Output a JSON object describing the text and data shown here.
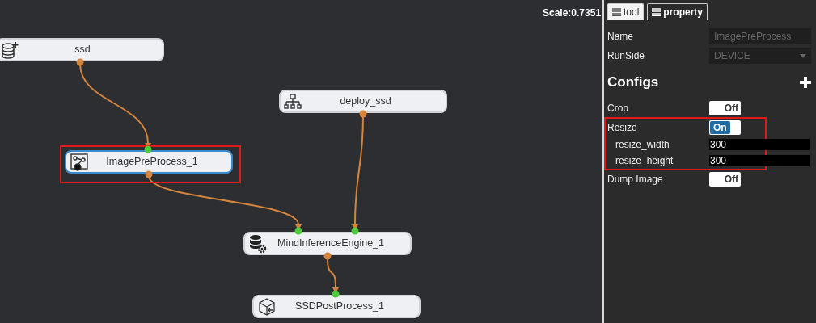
{
  "canvas": {
    "scale": "Scale:0.7351",
    "nodes": [
      {
        "label": "ssd",
        "selected": false,
        "highlighted": false
      },
      {
        "label": "deploy_ssd",
        "selected": false,
        "highlighted": false
      },
      {
        "label": "ImagePreProcess_1",
        "selected": true,
        "highlighted": true
      },
      {
        "label": "MindInferenceEngine_1",
        "selected": false,
        "highlighted": false
      },
      {
        "label": "SSDPostProcess_1",
        "selected": false,
        "highlighted": false
      }
    ]
  },
  "panel": {
    "tabs": [
      {
        "label": "tool",
        "selected": false
      },
      {
        "label": "property",
        "selected": true
      }
    ],
    "fields": [
      {
        "kind": "text",
        "label": "Name",
        "value": "ImagePreProcess",
        "disabled": true
      },
      {
        "kind": "select",
        "label": "RunSide",
        "value": "DEVICE",
        "disabled": true
      }
    ],
    "configs_title": "Configs",
    "configs": [
      {
        "kind": "toggle",
        "label": "Crop",
        "on": false,
        "toggle_text": "Off",
        "highlighted": false
      },
      {
        "kind": "toggle",
        "label": "Resize",
        "on": true,
        "toggle_text": "On",
        "highlighted": true,
        "children": [
          {
            "kind": "number",
            "label": "resize_width",
            "value": "300"
          },
          {
            "kind": "number",
            "label": "resize_height",
            "value": "300"
          }
        ]
      },
      {
        "kind": "toggle",
        "label": "Dump Image",
        "on": false,
        "toggle_text": "Off",
        "highlighted": false
      }
    ]
  }
}
